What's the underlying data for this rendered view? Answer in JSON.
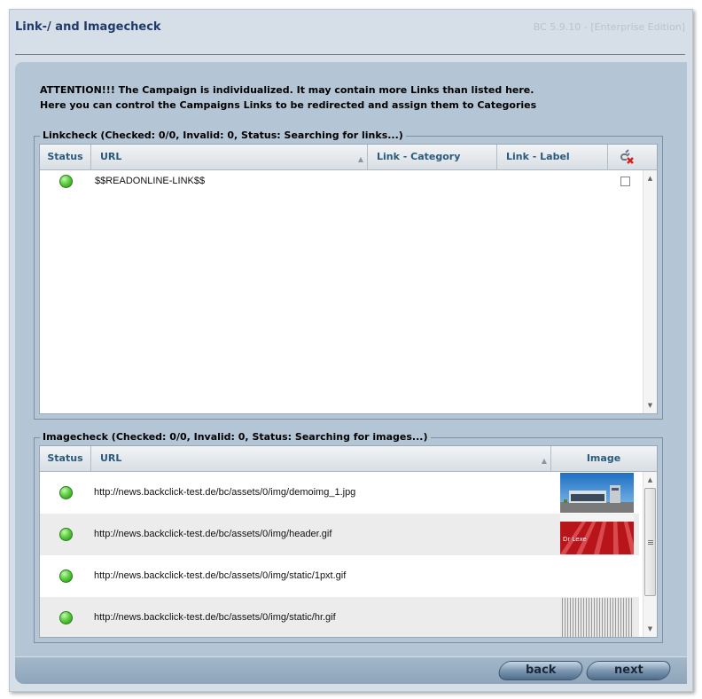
{
  "window": {
    "title": "Link-/ and Imagecheck",
    "version": "BC 5.9.10 - [Enterprise Edition]"
  },
  "attention": {
    "line1": "ATTENTION!!! The Campaign is individualized. It may contain more Links than listed here.",
    "line2": "Here you can control the Campaigns Links to be redirected and assign them to Categories"
  },
  "linkcheck": {
    "legend": "Linkcheck (Checked: 0/0, Invalid: 0, Status: Searching for links...)",
    "columns": {
      "status": "Status",
      "url": "URL",
      "category": "Link - Category",
      "label": "Link - Label"
    },
    "header_icon": "delete-link-icon",
    "rows": [
      {
        "status": "ok",
        "url": "$$READONLINE-LINK$$",
        "category": "",
        "label": "",
        "checked": false
      }
    ]
  },
  "imagecheck": {
    "legend": "Imagecheck (Checked: 0/0, Invalid: 0, Status: Searching for images...)",
    "columns": {
      "status": "Status",
      "url": "URL",
      "image": "Image"
    },
    "rows": [
      {
        "status": "ok",
        "url": "http://news.backclick-test.de/bc/assets/0/img/demoimg_1.jpg",
        "image": "building-photo"
      },
      {
        "status": "ok",
        "url": "http://news.backclick-test.de/bc/assets/0/img/header.gif",
        "image": "red-track-banner"
      },
      {
        "status": "ok",
        "url": "http://news.backclick-test.de/bc/assets/0/img/static/1pxt.gif",
        "image": ""
      },
      {
        "status": "ok",
        "url": "http://news.backclick-test.de/bc/assets/0/img/static/hr.gif",
        "image": "striped-line-pattern"
      }
    ],
    "banner_text": "Dr Lexe"
  },
  "footer": {
    "back_label": "back",
    "next_label": "next"
  },
  "colors": {
    "title": "#1f3b6b",
    "header_text": "#2a5b7d",
    "status_ok": "#44c02a",
    "panel": "#b4c5d5"
  }
}
